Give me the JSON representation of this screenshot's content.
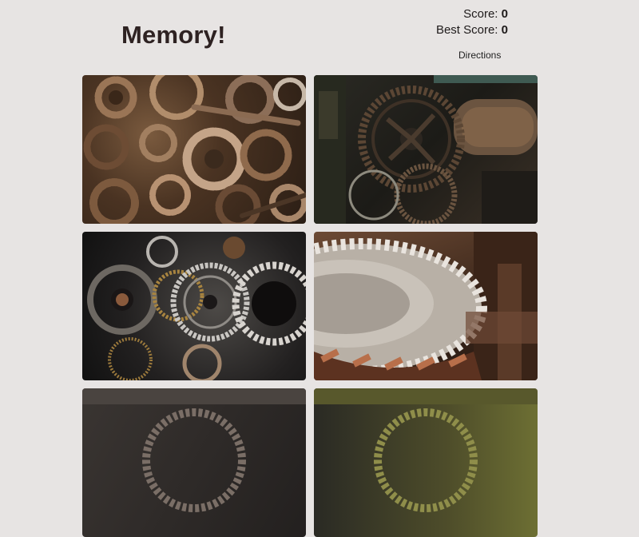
{
  "header": {
    "title": "Memory!",
    "score_label": "Score:",
    "score_value": "0",
    "best_score_label": "Best Score:",
    "best_score_value": "0",
    "directions_label": "Directions"
  },
  "cards": [
    {
      "image": "rusty-gears-pile"
    },
    {
      "image": "old-machine-gears"
    },
    {
      "image": "watch-movement-gears"
    },
    {
      "image": "large-gear-wheel"
    },
    {
      "image": "gear-card"
    },
    {
      "image": "gear-card"
    }
  ]
}
